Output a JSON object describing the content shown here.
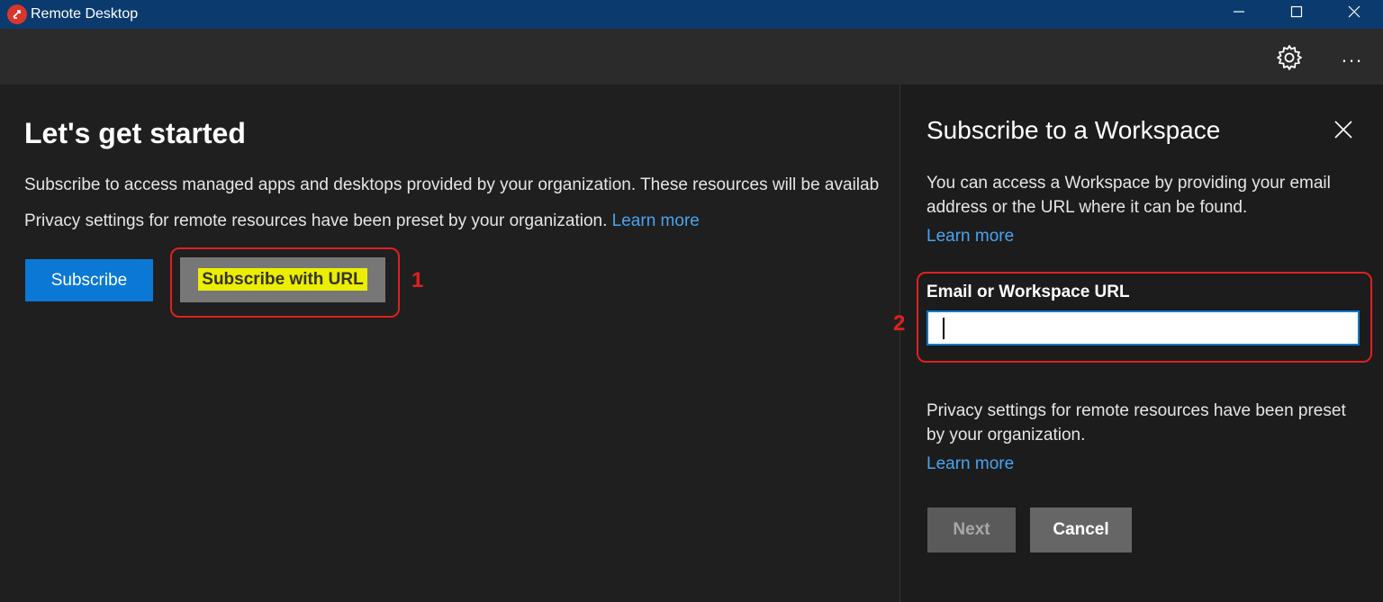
{
  "window": {
    "title": "Remote Desktop",
    "icon": "remote-desktop-icon",
    "controls": {
      "minimize": "minimize-icon",
      "maximize": "maximize-icon",
      "close": "close-icon"
    }
  },
  "toolbar": {
    "settings_icon": "gear-icon",
    "more_label": "..."
  },
  "main": {
    "title": "Let's get started",
    "description": "Subscribe to access managed apps and desktops provided by your organization. These resources will be availab",
    "privacy_text": "Privacy settings for remote resources have been preset by your organization.",
    "learn_more": "Learn more",
    "subscribe_label": "Subscribe",
    "subscribe_url_label": "Subscribe with URL",
    "annotation_1": "1"
  },
  "panel": {
    "title": "Subscribe to a Workspace",
    "description": "You can access a Workspace by providing your email address or the URL where it can be found.",
    "learn_more_1": "Learn more",
    "field_label": "Email or Workspace URL",
    "field_value": "",
    "annotation_2": "2",
    "privacy_text": "Privacy settings for remote resources have been preset by your organization.",
    "learn_more_2": "Learn more",
    "next_label": "Next",
    "cancel_label": "Cancel"
  },
  "colors": {
    "titlebar": "#0b3a6e",
    "accent": "#0a78d4",
    "link": "#4aa3f0",
    "annotation": "#e02020",
    "highlight": "#ecee00"
  }
}
